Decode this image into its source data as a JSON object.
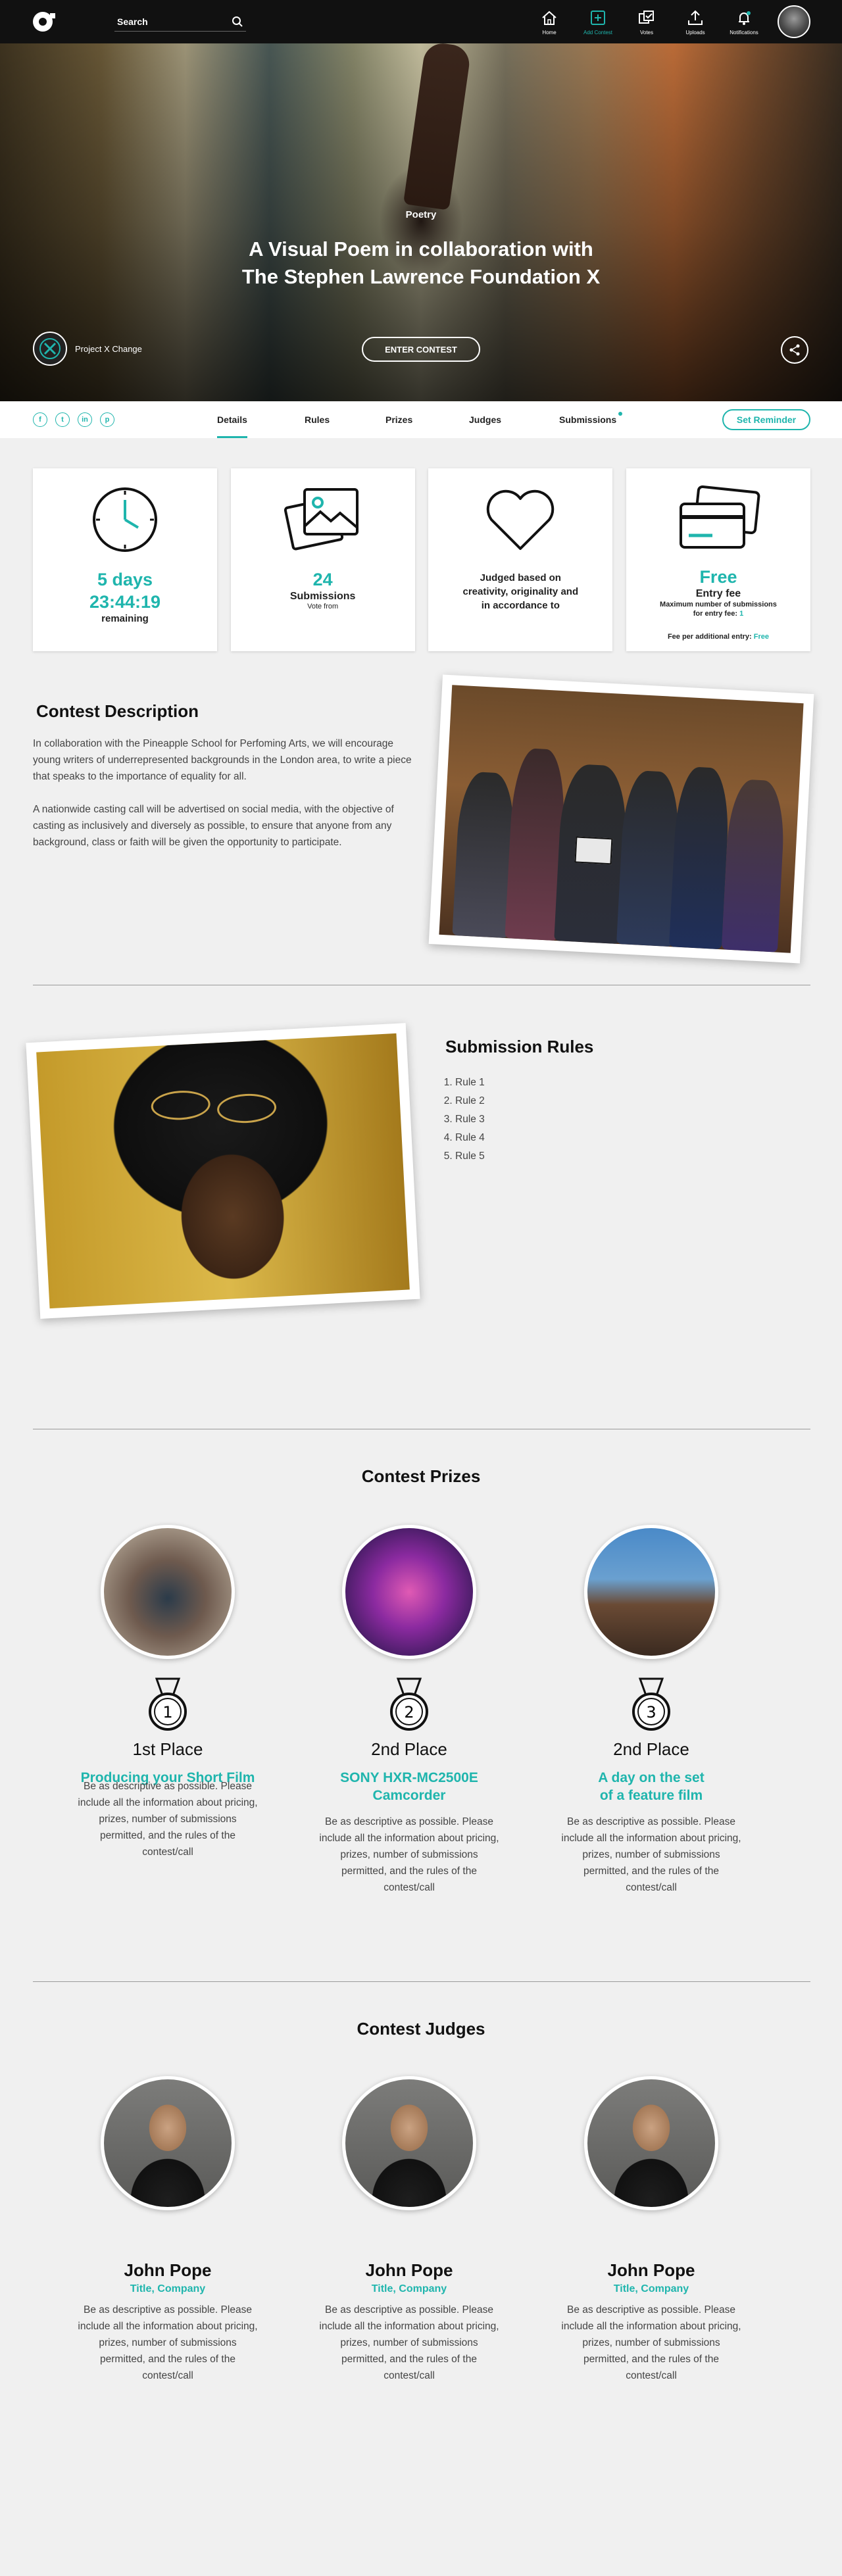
{
  "nav": {
    "search_placeholder": "Search",
    "items": [
      {
        "label": "Home",
        "icon": "home-icon"
      },
      {
        "label": "Add Contest",
        "icon": "add-contest-icon"
      },
      {
        "label": "Votes",
        "icon": "votes-icon"
      },
      {
        "label": "Uploads",
        "icon": "upload-icon"
      },
      {
        "label": "Notifications",
        "icon": "bell-icon"
      }
    ]
  },
  "hero": {
    "category": "Poetry",
    "title_line1": "A Visual Poem in collaboration with",
    "title_line2": "The Stephen Lawrence Foundation X",
    "org_name": "Project X Change",
    "enter_label": "ENTER CONTEST"
  },
  "tabs": {
    "socials": [
      "f",
      "t",
      "in",
      "p"
    ],
    "items": [
      "Details",
      "Rules",
      "Prizes",
      "Judges",
      "Submissions"
    ],
    "reminder_label": "Set Reminder"
  },
  "cards": {
    "time": {
      "days": "5 days",
      "clock": "23:44:19",
      "label": "remaining"
    },
    "submissions": {
      "count": "24",
      "label": "Submissions",
      "sub": "Vote from"
    },
    "judging": {
      "text": "Judged based on creativity, originality and in accordance to"
    },
    "fee": {
      "value": "Free",
      "label": "Entry fee",
      "max_label": "Maximum number of submissions",
      "per_fee_label": "for entry fee:",
      "per_fee_value": "1",
      "extra_label": "Fee per additional entry:",
      "extra_value": "Free"
    }
  },
  "description": {
    "title": "Contest Description",
    "p1": "In collaboration with the Pineapple School for Perfoming Arts, we will encourage young writers of underrepresented backgrounds in the London area, to write a piece that speaks to the importance of equality for all.",
    "p2": "A nationwide casting call will be advertised on social media, with the objective of casting as inclusively and diversely as possible, to ensure that anyone from any background, class or faith will be given the opportunity to participate."
  },
  "rules": {
    "title": "Submission Rules",
    "items": [
      "Rule 1",
      "Rule 2",
      "Rule 3",
      "Rule 4",
      "Rule 5"
    ]
  },
  "prizes": {
    "title": "Contest Prizes",
    "items": [
      {
        "medal": "1",
        "place": "1st Place",
        "name_line1": "Producing your Short Film",
        "name_line2": "",
        "desc": "Be as descriptive as possible. Please include all the information about pricing, prizes, number of submissions permitted, and the rules of the contest/call"
      },
      {
        "medal": "2",
        "place": "2nd Place",
        "name_line1": "SONY HXR-MC2500E",
        "name_line2": "Camcorder",
        "desc": "Be as descriptive as possible. Please include all the information about pricing, prizes, number of submissions permitted, and the rules of the contest/call"
      },
      {
        "medal": "3",
        "place": "2nd Place",
        "name_line1": "A day on the set",
        "name_line2": "of a feature film",
        "desc": "Be as descriptive as possible. Please include all the information about pricing, prizes, number of submissions permitted, and the rules of the contest/call"
      }
    ]
  },
  "judges": {
    "title": "Contest Judges",
    "items": [
      {
        "name": "John Pope",
        "title": "Title, Company",
        "desc": "Be as descriptive as possible. Please include all the information about pricing, prizes, number of submissions permitted, and the rules of the contest/call"
      },
      {
        "name": "John Pope",
        "title": "Title, Company",
        "desc": "Be as descriptive as possible. Please include all the information about pricing, prizes, number of submissions permitted, and the rules of the contest/call"
      },
      {
        "name": "John Pope",
        "title": "Title, Company",
        "desc": "Be as descriptive as possible. Please include all the information about pricing, prizes, number of submissions permitted, and the rules of the contest/call"
      }
    ]
  },
  "colors": {
    "accent": "#1fb5ad",
    "navbar": "#111111",
    "page_bg": "#f0f0f0"
  }
}
